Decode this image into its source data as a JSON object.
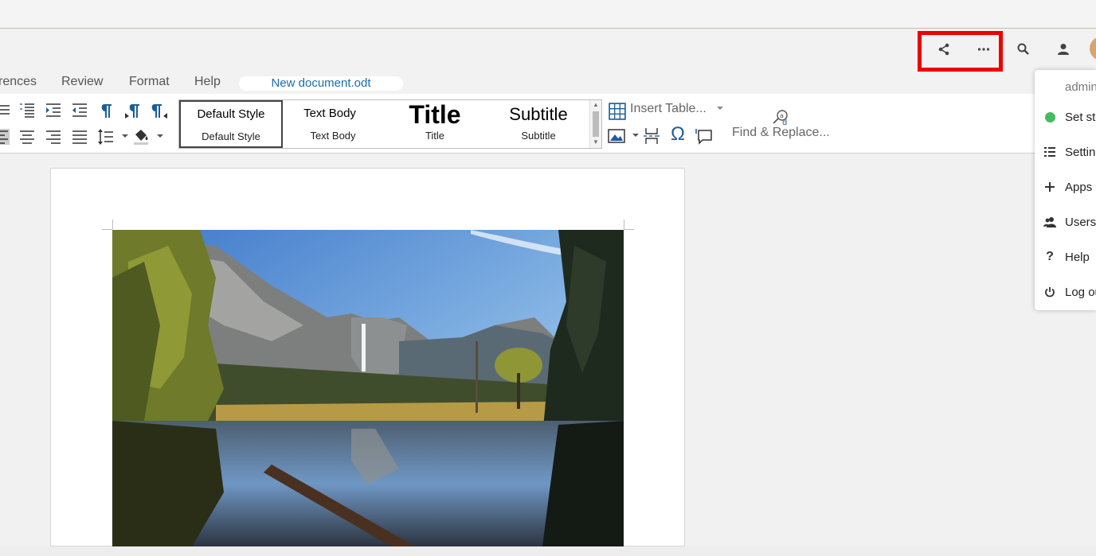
{
  "header": {
    "share_icon": "share-icon",
    "more_icon": "more-icon",
    "search_icon": "search-icon",
    "contacts_icon": "contacts-icon",
    "highlight_color": "#ee0000"
  },
  "menubar": {
    "items": [
      "rences",
      "Review",
      "Format",
      "Help"
    ],
    "document_name": "New document.odt"
  },
  "styles": {
    "items": [
      {
        "preview": "Default Style",
        "caption": "Default Style"
      },
      {
        "preview": "Text Body",
        "caption": "Text Body"
      },
      {
        "preview": "Title",
        "caption": "Title"
      },
      {
        "preview": "Subtitle",
        "caption": "Subtitle"
      }
    ]
  },
  "toolbar": {
    "insert_table": "Insert Table...",
    "find_replace": "Find & Replace...",
    "special_char": "Ω"
  },
  "user_menu": {
    "username": "admin",
    "items": [
      {
        "label": "Set status",
        "icon": "status-dot-icon",
        "color": "#46ba61"
      },
      {
        "label": "Settings",
        "icon": "settings-list-icon"
      },
      {
        "label": "Apps",
        "icon": "plus-icon"
      },
      {
        "label": "Users",
        "icon": "users-icon"
      },
      {
        "label": "Help",
        "icon": "help-icon"
      },
      {
        "label": "Log out",
        "icon": "power-icon"
      }
    ]
  }
}
